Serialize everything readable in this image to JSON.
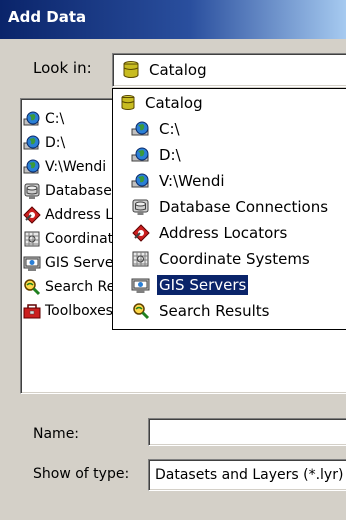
{
  "window": {
    "title": "Add Data"
  },
  "look_in": {
    "label": "Look in:",
    "value": "Catalog",
    "icon": "catalog-icon"
  },
  "browser_list": {
    "items": [
      {
        "label": "C:\\",
        "icon": "drive-globe-icon"
      },
      {
        "label": "D:\\",
        "icon": "drive-globe-icon"
      },
      {
        "label": "V:\\Wendi",
        "icon": "drive-globe-icon"
      },
      {
        "label": "Database Connections",
        "icon": "database-connections-icon"
      },
      {
        "label": "Address Locators",
        "icon": "address-locators-icon"
      },
      {
        "label": "Coordinate Systems",
        "icon": "coordinate-systems-icon"
      },
      {
        "label": "GIS Servers",
        "icon": "gis-servers-icon"
      },
      {
        "label": "Search Results",
        "icon": "search-results-icon"
      },
      {
        "label": "Toolboxes",
        "icon": "toolboxes-icon"
      }
    ]
  },
  "dropdown": {
    "items": [
      {
        "label": "Catalog",
        "icon": "catalog-icon",
        "selected": false
      },
      {
        "label": "C:\\",
        "icon": "drive-globe-icon",
        "selected": false
      },
      {
        "label": "D:\\",
        "icon": "drive-globe-icon",
        "selected": false
      },
      {
        "label": "V:\\Wendi",
        "icon": "drive-globe-icon",
        "selected": false
      },
      {
        "label": "Database Connections",
        "icon": "database-connections-icon",
        "selected": false
      },
      {
        "label": "Address Locators",
        "icon": "address-locators-icon",
        "selected": false
      },
      {
        "label": "Coordinate Systems",
        "icon": "coordinate-systems-icon",
        "selected": false
      },
      {
        "label": "GIS Servers",
        "icon": "gis-servers-icon",
        "selected": true
      },
      {
        "label": "Search Results",
        "icon": "search-results-icon",
        "selected": false
      }
    ]
  },
  "name_field": {
    "label": "Name:",
    "value": ""
  },
  "show_type": {
    "label": "Show of type:",
    "value": "Datasets and Layers (*.lyr)"
  },
  "colors": {
    "title_bar": "#0a246a",
    "selection": "#0a246a",
    "face": "#d4d0c8"
  }
}
